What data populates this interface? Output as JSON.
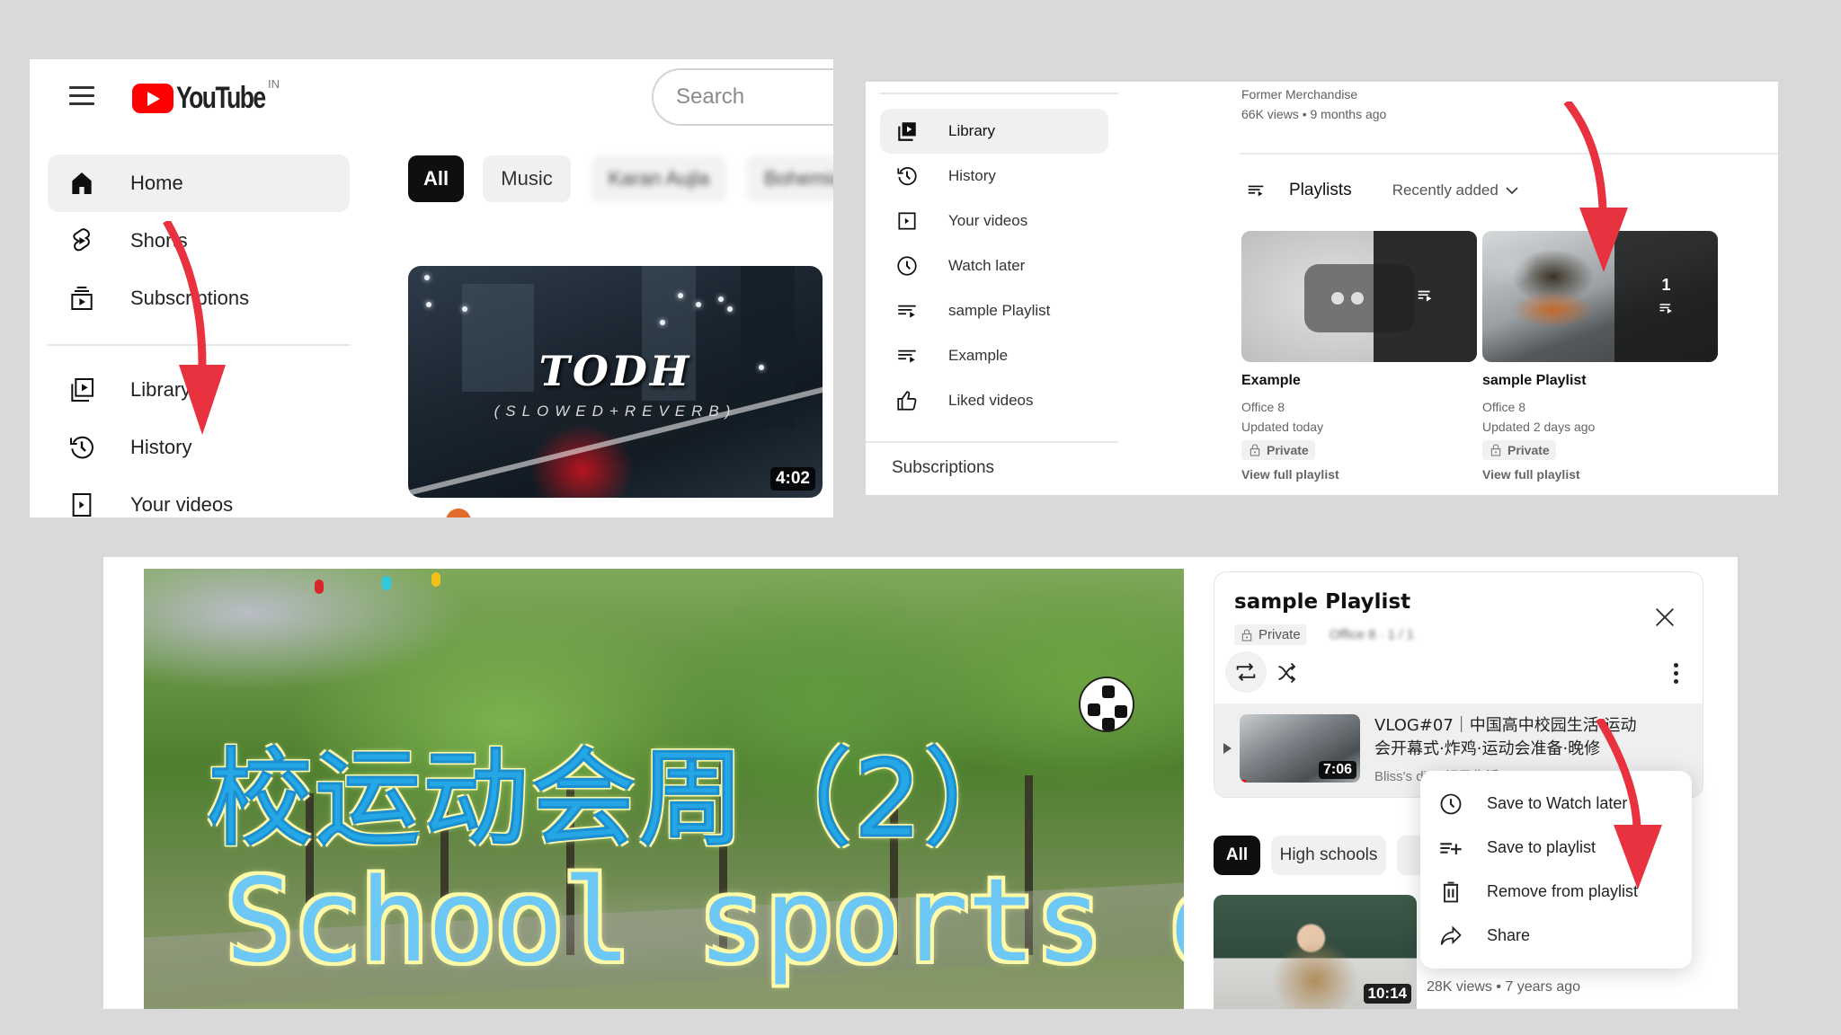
{
  "panel_home": {
    "logo_text": "YouTube",
    "country_code": "IN",
    "search_placeholder": "Search",
    "sidebar": [
      {
        "label": "Home",
        "icon": "home-icon",
        "active": true
      },
      {
        "label": "Shorts",
        "icon": "shorts-icon"
      },
      {
        "label": "Subscriptions",
        "icon": "subscriptions-icon"
      },
      {
        "label": "Library",
        "icon": "library-icon"
      },
      {
        "label": "History",
        "icon": "history-icon"
      },
      {
        "label": "Your videos",
        "icon": "your-videos-icon"
      }
    ],
    "chips": [
      "All",
      "Music",
      "Karan Aujla",
      "Bohemia"
    ],
    "video": {
      "thumb_title": "TODH",
      "thumb_subtitle": "(SLOWED+REVERB)",
      "duration": "4:02"
    }
  },
  "panel_library": {
    "sidebar": [
      {
        "label": "Library",
        "icon": "library-icon",
        "active": true
      },
      {
        "label": "History",
        "icon": "history-icon"
      },
      {
        "label": "Your videos",
        "icon": "your-videos-icon"
      },
      {
        "label": "Watch later",
        "icon": "watch-later-icon"
      },
      {
        "label": "sample Playlist",
        "icon": "playlist-icon"
      },
      {
        "label": "Example",
        "icon": "playlist-icon"
      },
      {
        "label": "Liked videos",
        "icon": "thumbs-up-icon"
      }
    ],
    "subscriptions_heading": "Subscriptions",
    "prev_video": {
      "channel": "Former Merchandise",
      "meta": "66K views • 9 months ago"
    },
    "playlists_heading": "Playlists",
    "sort_label": "Recently added",
    "playlists": [
      {
        "name": "Example",
        "owner": "Office 8",
        "updated": "Updated today",
        "privacy": "Private",
        "link": "View full playlist",
        "count": ""
      },
      {
        "name": "sample Playlist",
        "owner": "Office 8",
        "updated": "Updated 2 days ago",
        "privacy": "Private",
        "link": "View full playlist",
        "count": "1"
      }
    ]
  },
  "panel_watch": {
    "thumb_title_cn": "校运动会周（2）",
    "thumb_title_en": "School sports day",
    "playlist": {
      "title": "sample Playlist",
      "privacy": "Private",
      "owner_count": "Office 8 · 1 / 1",
      "item": {
        "title": "VLOG#07｜中国高中校园生活·运动会开幕式·炸鸡·运动会准备·晚修",
        "channel": "Bliss's diary记录生活",
        "duration": "7:06",
        "progress": 0.05
      }
    },
    "chips": [
      "All",
      "High schools"
    ],
    "related": {
      "duration": "10:14",
      "meta": "28K views  • 7 years ago"
    },
    "menu": [
      {
        "label": "Save to Watch later",
        "icon": "clock-icon"
      },
      {
        "label": "Save to playlist",
        "icon": "playlist-add-icon"
      },
      {
        "label": "Remove from playlist",
        "icon": "trash-icon"
      },
      {
        "label": "Share",
        "icon": "share-icon"
      }
    ]
  },
  "colors": {
    "arrow": "#e8323f",
    "brand_red": "#ff0000",
    "page_bg": "#d9d9d9"
  }
}
